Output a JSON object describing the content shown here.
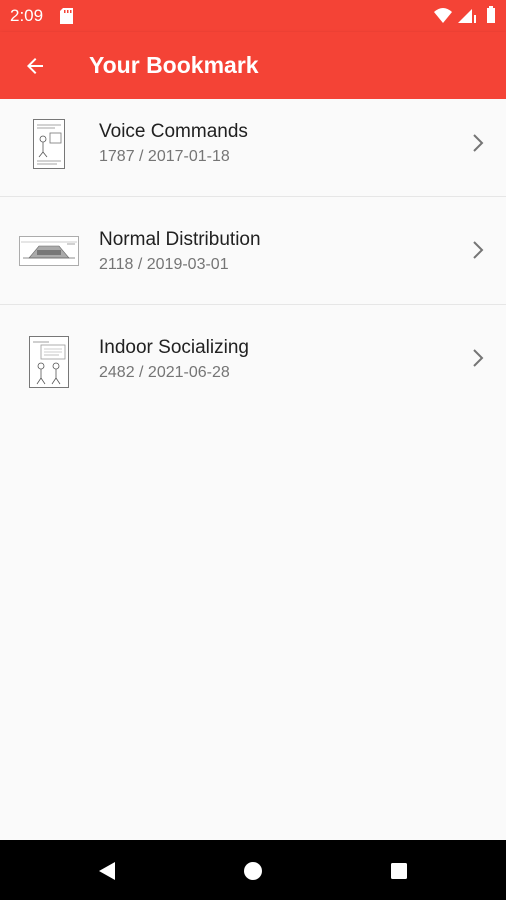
{
  "status_bar": {
    "time": "2:09",
    "icons": [
      "sd-card-icon",
      "wifi-icon",
      "signal-icon",
      "battery-icon"
    ]
  },
  "app_bar": {
    "title": "Your Bookmark",
    "back_icon": "arrow-back-icon",
    "background": "#f44336"
  },
  "bookmarks": [
    {
      "title": "Voice Commands",
      "subtitle": "1787 / 2017-01-18",
      "thumbnail": "comic-thumbnail"
    },
    {
      "title": "Normal Distribution",
      "subtitle": "2118 / 2019-03-01",
      "thumbnail": "comic-thumbnail"
    },
    {
      "title": "Indoor Socializing",
      "subtitle": "2482 / 2021-06-28",
      "thumbnail": "comic-thumbnail"
    }
  ],
  "nav_bar": {
    "buttons": [
      "back-triangle-icon",
      "home-circle-icon",
      "recents-square-icon"
    ]
  }
}
